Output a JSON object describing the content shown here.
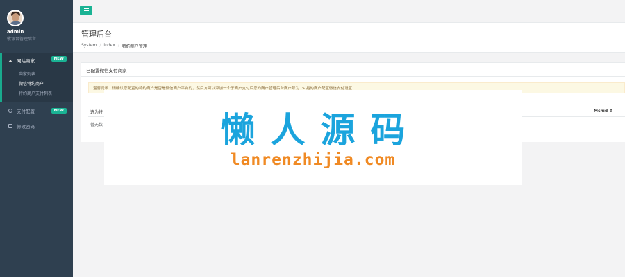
{
  "profile": {
    "name": "admin",
    "role": "收银台管理后台"
  },
  "sidebar": {
    "items": [
      {
        "label": "网站商家",
        "badge": "NEW",
        "icon": "home-icon",
        "children": [
          {
            "label": "商家列表"
          },
          {
            "label": "微信特约商户"
          },
          {
            "label": "特约商户支付列表"
          }
        ]
      },
      {
        "label": "支付配置",
        "badge": "NEW",
        "icon": "gear-icon"
      },
      {
        "label": "修改密码",
        "icon": "lock-icon"
      }
    ]
  },
  "topbar": {
    "menu_icon": "hamburger-icon"
  },
  "heading": {
    "title": "管理后台",
    "breadcrumb": [
      "System",
      "index",
      "特约商户管理"
    ]
  },
  "panel": {
    "title": "已配置微信支付商家",
    "alert": "温馨提示：请确认您配置的特约商户是否是微信商户平台的，然后方可以添加一个子商户支付后您的商户管理后台商户号为 :> 指的商户配置微信支付设置",
    "table": {
      "columns": [
        "选为特",
        "Mchid ⇕"
      ],
      "empty": "暂无数"
    }
  },
  "watermark": {
    "cn": "懒人源码",
    "en": "lanrenzhijia.com"
  },
  "colors": {
    "sidebar": "#2f4050",
    "accent": "#1ab394",
    "watermark_blue": "#1ba4dd",
    "watermark_orange": "#f08a24"
  }
}
